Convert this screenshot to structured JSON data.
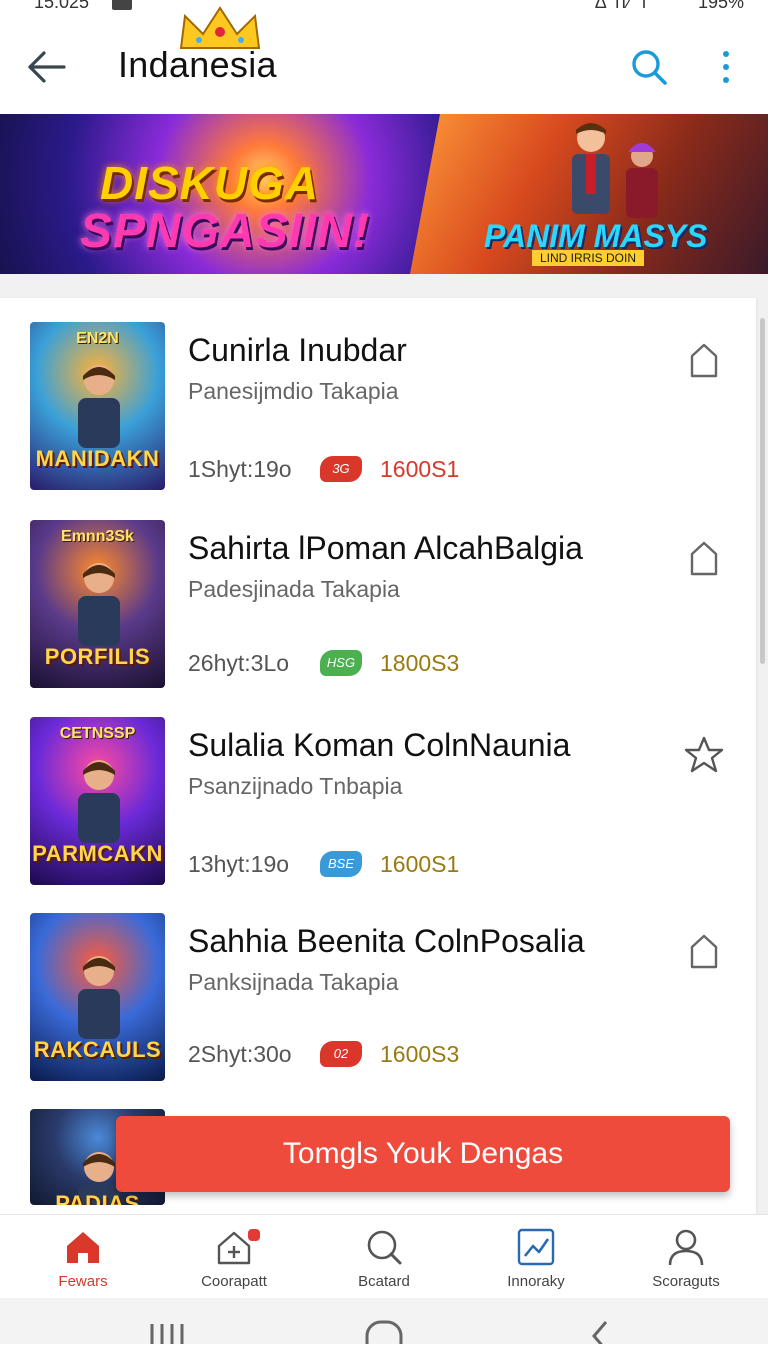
{
  "status_bar": {
    "time": "15:025",
    "battery": "195%",
    "signal": "°Δ ıl⁄°l"
  },
  "app_bar": {
    "title": "Indanesia"
  },
  "banner": {
    "left_line1": "DISKUGA",
    "left_line2": "SPNGASIIN!",
    "right_title": "PANIM MASYS",
    "right_sub": "LIND IRRIS DOIN"
  },
  "games": [
    {
      "title": "Cunirla Inubdar",
      "subtitle": "Panesijmdio   Takapia",
      "size": "1Shyt:19o",
      "badge": "3G",
      "badge_color": "#d8372a",
      "price": "1600S1",
      "price_color": "#d8372a",
      "action_icon": "bookmark-icon",
      "thumb_top": "EN2N",
      "thumb_label": "MANIDAKN",
      "thumb_colors": [
        "#ffb236",
        "#3aa0d8",
        "#2a1a6a"
      ]
    },
    {
      "title": "Sahirta lPoman AlcahBalgia",
      "subtitle": "Padesjinada   Takapia",
      "size": "26hyt:3Lo",
      "badge": "HSG",
      "badge_color": "#4caf50",
      "price": "1800S3",
      "price_color": "#9a7a10",
      "action_icon": "bookmark-icon",
      "thumb_top": "Emnn3Sk",
      "thumb_label": "PORFILIS",
      "thumb_colors": [
        "#ff8a2a",
        "#5a3a8a",
        "#1a1030"
      ]
    },
    {
      "title": "Sulalia Koman ColnNaunia",
      "subtitle": "Psanzijnado   Tnbapia",
      "size": "13hyt:19o",
      "badge": "BSE",
      "badge_color": "#3a9ad8",
      "price": "1600S1",
      "price_color": "#9a7a10",
      "action_icon": "star-icon",
      "thumb_top": "CETNSSP",
      "thumb_label": "PARMCAKN",
      "thumb_colors": [
        "#ff4aa0",
        "#6a2ad8",
        "#1a0a4a"
      ]
    },
    {
      "title": "Sahhia Beenita ColnPosalia",
      "subtitle": "Panksijnada   Takapia",
      "size": "2Shyt:30o",
      "badge": "02",
      "badge_color": "#d8372a",
      "price": "1600S3",
      "price_color": "#9a7a10",
      "action_icon": "bookmark-icon",
      "thumb_top": "",
      "thumb_label": "RAKCAULS",
      "thumb_colors": [
        "#ff5a3a",
        "#3a6ad8",
        "#0a1a4a"
      ]
    },
    {
      "title": "",
      "subtitle": "",
      "size": "",
      "badge": "",
      "badge_color": "#d8372a",
      "price": "",
      "price_color": "#9a7a10",
      "action_icon": "",
      "thumb_top": "",
      "thumb_label": "PADIAS",
      "thumb_colors": [
        "#4a8ad8",
        "#2a3a6a",
        "#101830"
      ]
    }
  ],
  "cta": {
    "label": "Tomgls Youk Dengas"
  },
  "bottom_nav": [
    {
      "label": "Fewars",
      "icon": "home-icon",
      "active": true
    },
    {
      "label": "Coorapatt",
      "icon": "home-plus-icon",
      "active": false,
      "dot": true
    },
    {
      "label": "Bcatard",
      "icon": "search-icon",
      "active": false
    },
    {
      "label": "Innoraky",
      "icon": "chart-icon",
      "active": false
    },
    {
      "label": "Scoraguts",
      "icon": "profile-icon",
      "active": false
    }
  ],
  "colors": {
    "accent": "#ef4b3c",
    "nav_active": "#d9392b",
    "search_icon": "#1a9ad8"
  }
}
